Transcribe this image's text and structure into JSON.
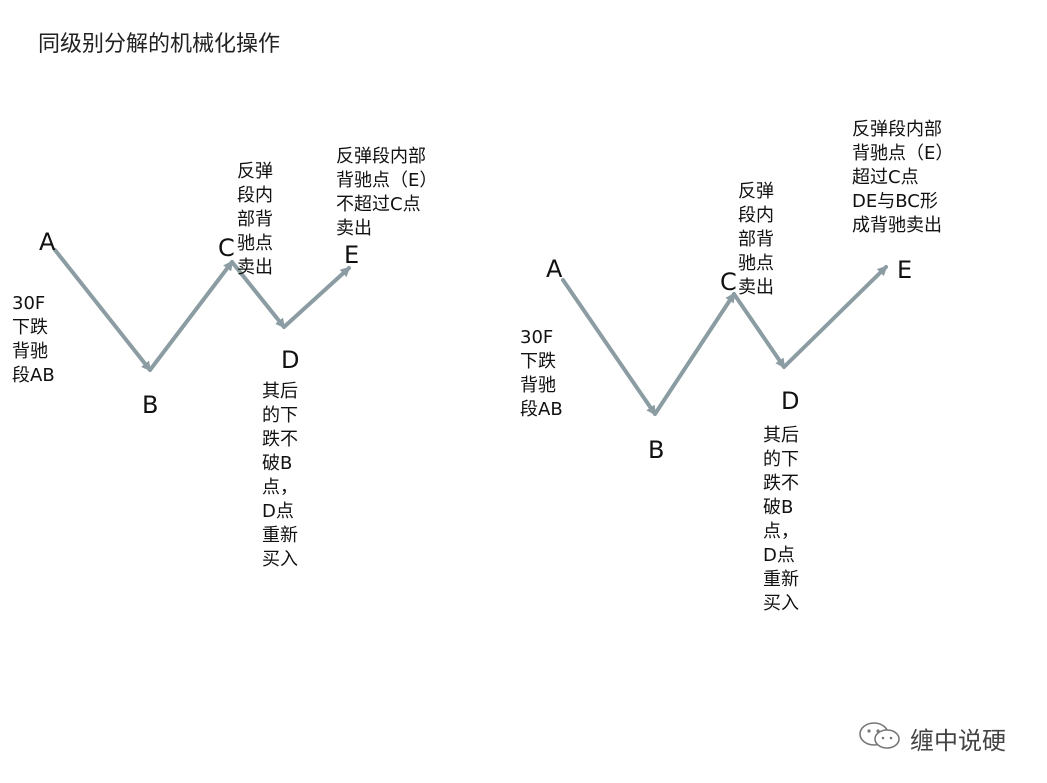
{
  "title": "同级别分解的机械化操作",
  "diagrams": [
    {
      "points": {
        "A": "A",
        "B": "B",
        "C": "C",
        "D": "D",
        "E": "E"
      },
      "note_ab": "30F\n下跌\n背驰\n段AB",
      "note_c": "反弹\n段内\n部背\n驰点\n卖出",
      "note_d": "其后\n的下\n跌不\n破B\n点，\nD点\n重新\n买入",
      "note_e": "反弹段内部\n背驰点（E）\n不超过C点\n卖出"
    },
    {
      "points": {
        "A": "A",
        "B": "B",
        "C": "C",
        "D": "D",
        "E": "E"
      },
      "note_ab": "30F\n下跌\n背驰\n段AB",
      "note_c": "反弹\n段内\n部背\n驰点\n卖出",
      "note_d": "其后\n的下\n跌不\n破B\n点，\nD点\n重新\n买入",
      "note_e": "反弹段内部\n背驰点（E）\n超过C点\nDE与BC形\n成背驰卖出"
    }
  ],
  "watermark": "缠中说硬",
  "colors": {
    "arrow": "#8c9ca3",
    "text": "#111111",
    "watermark": "#444444"
  },
  "icons": {
    "watermark_logo": "wechat-icon"
  }
}
